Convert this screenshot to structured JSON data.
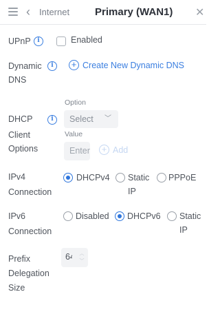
{
  "header": {
    "breadcrumb": "Internet",
    "title": "Primary (WAN1)",
    "menu_icon": "hamburger-menu-icon",
    "back_icon": "chevron-left-icon",
    "close_icon": "close-icon"
  },
  "upnp": {
    "label": "UPnP",
    "checkbox_label": "Enabled",
    "checked": false
  },
  "dynamic_dns": {
    "label_line1": "Dynamic",
    "label_line2": "DNS",
    "create_link": "Create New Dynamic DNS"
  },
  "dhcp_client_options": {
    "label_line1": "DHCP",
    "label_line2": "Client",
    "label_line3": "Options",
    "option_caption": "Option",
    "option_select": "Select",
    "value_caption": "Value",
    "value_placeholder": "Enter value",
    "add_label": "Add"
  },
  "ipv4": {
    "label_line1": "IPv4",
    "label_line2": "Connection",
    "options": [
      "DHCPv4",
      "Static",
      "PPPoE"
    ],
    "option_static_line2": "IP",
    "selected": "DHCPv4"
  },
  "ipv6": {
    "label_line1": "IPv6",
    "label_line2": "Connection",
    "options": [
      "Disabled",
      "DHCPv6",
      "Static"
    ],
    "option_static_line2": "IP",
    "selected": "DHCPv6"
  },
  "prefix_delegation": {
    "label_line1": "Prefix",
    "label_line2": "Delegation",
    "label_line3": "Size",
    "value": "64"
  },
  "colors": {
    "accent": "#2f76dc",
    "text": "#4f545c",
    "field_bg": "#f2f3f5"
  }
}
